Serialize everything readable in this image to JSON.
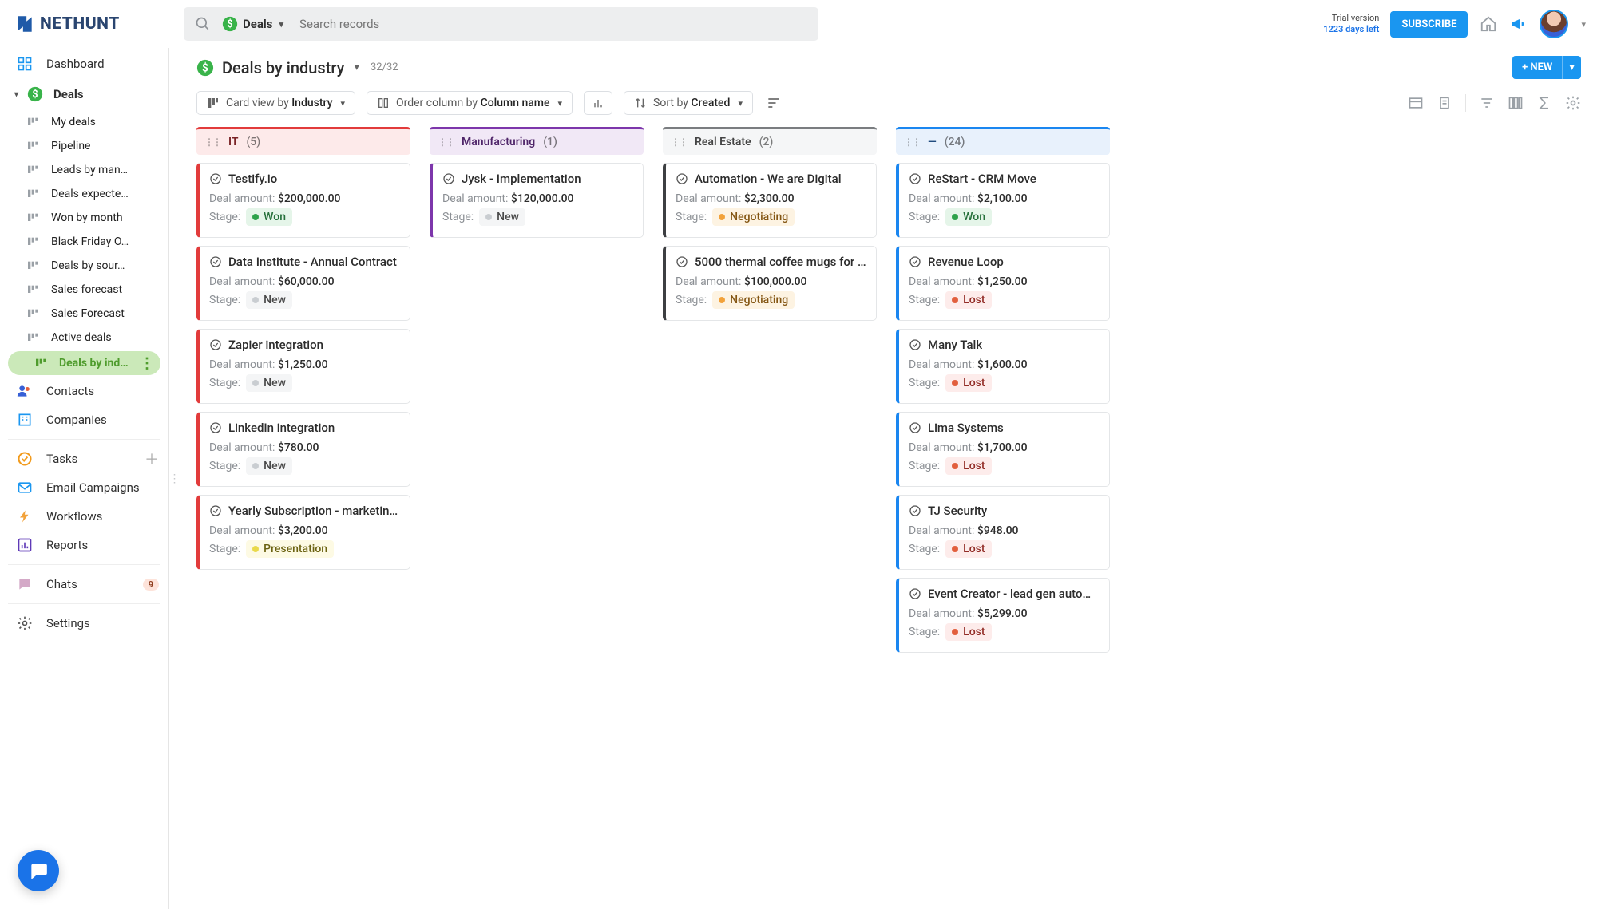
{
  "topbar": {
    "brand": "NETHUNT",
    "search_scope": "Deals",
    "search_placeholder": "Search records",
    "trial_line1": "Trial version",
    "trial_line2": "1223 days left",
    "subscribe": "SUBSCRIBE"
  },
  "sidebar": {
    "dashboard": "Dashboard",
    "deals": "Deals",
    "sub": [
      "My deals",
      "Pipeline",
      "Leads by man…",
      "Deals expecte…",
      "Won by month",
      "Black Friday O…",
      "Deals by sour…",
      "Sales forecast",
      "Sales Forecast",
      "Active deals",
      "Deals by indu…"
    ],
    "contacts": "Contacts",
    "companies": "Companies",
    "tasks": "Tasks",
    "email": "Email Campaigns",
    "workflows": "Workflows",
    "reports": "Reports",
    "chats": "Chats",
    "chats_badge": "9",
    "settings": "Settings"
  },
  "header": {
    "title": "Deals by industry",
    "count": "32/32",
    "new_btn": "+ NEW"
  },
  "toolbar": {
    "card_view_prefix": "Card view by ",
    "card_view_value": "Industry",
    "order_prefix": "Order column by ",
    "order_value": "Column name",
    "sort_prefix": "Sort by ",
    "sort_value": "Created"
  },
  "labels": {
    "deal_amount": "Deal amount: ",
    "stage": "Stage:"
  },
  "columns": [
    {
      "key": "it",
      "name": "IT",
      "count": "(5)",
      "color": "#e23b3b",
      "cards": [
        {
          "title": "Testify.io",
          "amount": "$200,000.00",
          "stage": "Won",
          "stage_key": "won"
        },
        {
          "title": "Data Institute - Annual Contract",
          "amount": "$60,000.00",
          "stage": "New",
          "stage_key": "new"
        },
        {
          "title": "Zapier integration",
          "amount": "$1,250.00",
          "stage": "New",
          "stage_key": "new"
        },
        {
          "title": "LinkedIn integration",
          "amount": "$780.00",
          "stage": "New",
          "stage_key": "new"
        },
        {
          "title": "Yearly Subscription - marketing t…",
          "amount": "$3,200.00",
          "stage": "Presentation",
          "stage_key": "pres"
        }
      ]
    },
    {
      "key": "mf",
      "name": "Manufacturing",
      "count": "(1)",
      "color": "#7d36ab",
      "cards": [
        {
          "title": "Jysk - Implementation",
          "amount": "$120,000.00",
          "stage": "New",
          "stage_key": "new"
        }
      ]
    },
    {
      "key": "re",
      "name": "Real Estate",
      "count": "(2)",
      "color": "#3d3f42",
      "cards": [
        {
          "title": "Automation - We are Digital",
          "amount": "$2,300.00",
          "stage": "Negotiating",
          "stage_key": "neg"
        },
        {
          "title": "5000 thermal coffee mugs for N…",
          "amount": "$100,000.00",
          "stage": "Negotiating",
          "stage_key": "neg"
        }
      ]
    },
    {
      "key": "un",
      "name": "—",
      "count": "(24)",
      "color": "#1a86f0",
      "cards": [
        {
          "title": "ReStart - CRM Move",
          "amount": "$2,100.00",
          "stage": "Won",
          "stage_key": "won"
        },
        {
          "title": "Revenue Loop",
          "amount": "$1,250.00",
          "stage": "Lost",
          "stage_key": "lost"
        },
        {
          "title": "Many Talk",
          "amount": "$1,600.00",
          "stage": "Lost",
          "stage_key": "lost"
        },
        {
          "title": "Lima Systems",
          "amount": "$1,700.00",
          "stage": "Lost",
          "stage_key": "lost"
        },
        {
          "title": "TJ Security",
          "amount": "$948.00",
          "stage": "Lost",
          "stage_key": "lost"
        },
        {
          "title": "Event Creator - lead gen automa…",
          "amount": "$5,299.00",
          "stage": "Lost",
          "stage_key": "lost"
        }
      ]
    }
  ]
}
